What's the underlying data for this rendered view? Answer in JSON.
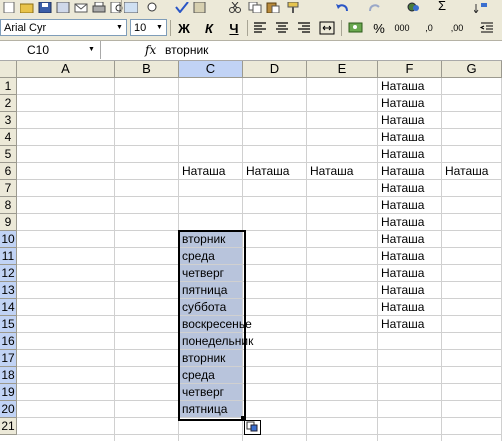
{
  "toolbar": {
    "font_name": "Arial Cyr",
    "font_size": "10",
    "bold_label": "Ж",
    "italic_label": "К",
    "underline_label": "Ч",
    "percent_label": "%",
    "thousands_label": "000",
    "inc_decimal_label": ",0",
    "dec_decimal_label": ",00",
    "sigma_label": "Σ"
  },
  "formula_bar": {
    "name_box": "C10",
    "fx": "fx",
    "value": "вторник"
  },
  "grid": {
    "columns": [
      "A",
      "B",
      "C",
      "D",
      "E",
      "F",
      "G"
    ],
    "rows": [
      "1",
      "2",
      "3",
      "4",
      "5",
      "6",
      "7",
      "8",
      "9",
      "10",
      "11",
      "12",
      "13",
      "14",
      "15",
      "16",
      "17",
      "18",
      "19",
      "20",
      "21"
    ],
    "active_column": "C",
    "cells": {
      "F1": "Наташа",
      "F2": "Наташа",
      "F3": "Наташа",
      "F4": "Наташа",
      "F5": "Наташа",
      "C6": "Наташа",
      "D6": "Наташа",
      "E6": "Наташа",
      "F6": "Наташа",
      "G6": "Наташа",
      "F7": "Наташа",
      "F8": "Наташа",
      "F9": "Наташа",
      "C10": "вторник",
      "F10": "Наташа",
      "C11": "среда",
      "F11": "Наташа",
      "C12": "четверг",
      "F12": "Наташа",
      "C13": "пятница",
      "F13": "Наташа",
      "C14": "суббота",
      "F14": "Наташа",
      "C15": "воскресенье",
      "F15": "Наташа",
      "C16": "понедельник",
      "C17": "вторник",
      "C18": "среда",
      "C19": "четверг",
      "C20": "пятница"
    }
  }
}
